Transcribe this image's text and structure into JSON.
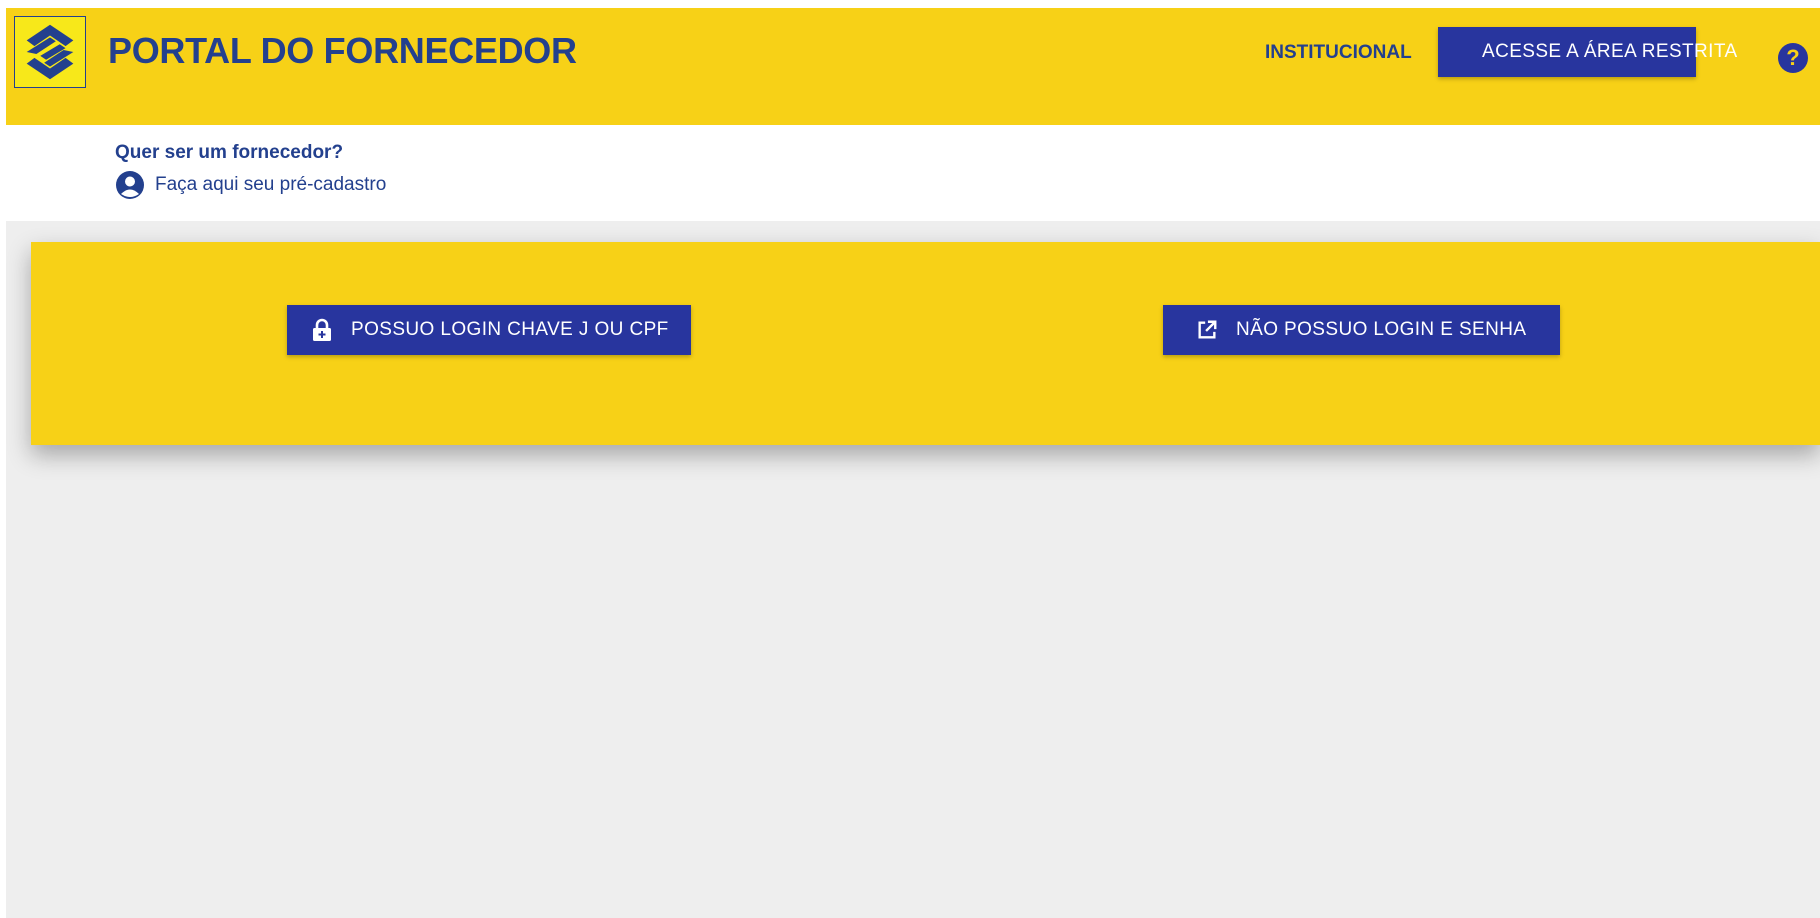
{
  "colors": {
    "brand_yellow": "#f7d117",
    "brand_blue": "#23408e",
    "button_blue": "#28359e",
    "background_gray": "#eeeeee"
  },
  "header": {
    "logo_icon": "banco-do-brasil-logo",
    "title": "PORTAL DO FORNECEDOR",
    "institucional_link": "INSTITUCIONAL",
    "restricted_button": {
      "icon": "lock-icon",
      "label": "ACESSE A ÁREA RESTRITA"
    },
    "help_icon": {
      "name": "help-icon",
      "glyph": "?"
    }
  },
  "subheader": {
    "question": "Quer ser um fornecedor?",
    "pre_register_link": {
      "icon": "user-circle-icon",
      "label": "Faça aqui seu pré-cadastro"
    }
  },
  "banner": {
    "login_button": {
      "icon": "lock-icon",
      "label": "POSSUO LOGIN CHAVE J OU CPF"
    },
    "no_login_button": {
      "icon": "external-link-icon",
      "label": "NÃO POSSUO LOGIN E SENHA"
    }
  }
}
